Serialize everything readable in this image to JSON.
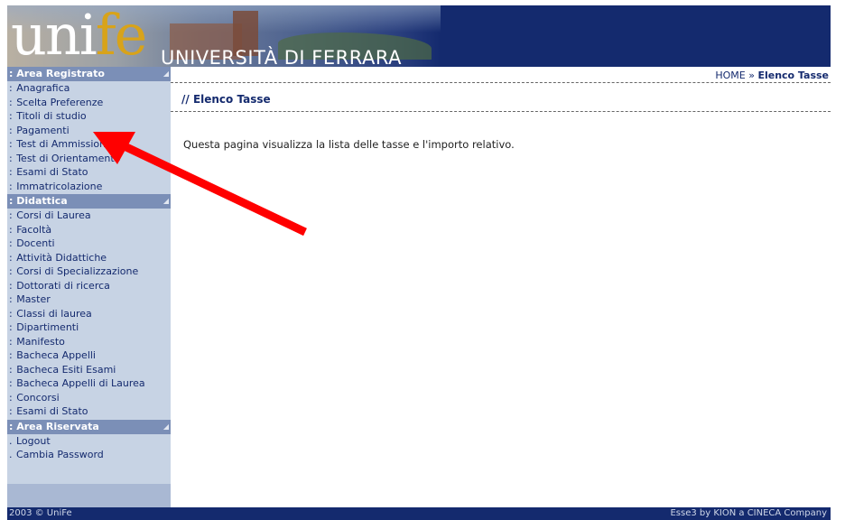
{
  "banner": {
    "logo_uni": "uni",
    "logo_fe": "fe",
    "university_name": "UNIVERSITÀ DI FERRARA"
  },
  "sidebar": {
    "area_registrato": {
      "header": ": Area Registrato",
      "items": [
        {
          "label": "Anagrafica"
        },
        {
          "label": "Scelta Preferenze"
        },
        {
          "label": "Titoli di studio"
        },
        {
          "label": "Pagamenti"
        },
        {
          "label": "Test di Ammissione"
        },
        {
          "label": "Test di Orientamento"
        },
        {
          "label": "Esami di Stato"
        },
        {
          "label": "Immatricolazione"
        }
      ]
    },
    "didattica": {
      "header": ": Didattica",
      "items": [
        {
          "label": "Corsi di Laurea"
        },
        {
          "label": "Facoltà"
        },
        {
          "label": "Docenti"
        },
        {
          "label": "Attività Didattiche"
        },
        {
          "label": "Corsi di Specializzazione"
        },
        {
          "label": "Dottorati di ricerca"
        },
        {
          "label": "Master"
        },
        {
          "label": "Classi di laurea"
        },
        {
          "label": "Dipartimenti"
        },
        {
          "label": "Manifesto"
        },
        {
          "label": "Bacheca Appelli"
        },
        {
          "label": "Bacheca Esiti Esami"
        },
        {
          "label": "Bacheca Appelli di Laurea"
        },
        {
          "label": "Concorsi"
        },
        {
          "label": "Esami di Stato"
        }
      ]
    },
    "area_riservata": {
      "header": ": Area Riservata",
      "items": [
        {
          "label": "Logout"
        },
        {
          "label": "Cambia Password"
        }
      ]
    }
  },
  "breadcrumb": {
    "home": "HOME",
    "separator": "»",
    "current": "Elenco Tasse"
  },
  "main": {
    "title": "// Elenco Tasse",
    "description": "Questa pagina visualizza la lista delle tasse e l'importo relativo."
  },
  "footer": {
    "left": "2003 © UniFe",
    "right": "Esse3 by KION a CINECA Company"
  },
  "colors": {
    "navy": "#142a6e",
    "sidebar_bg": "#c7d3e4",
    "section_header": "#7b8fb7",
    "annotation_arrow": "#ff0000"
  }
}
